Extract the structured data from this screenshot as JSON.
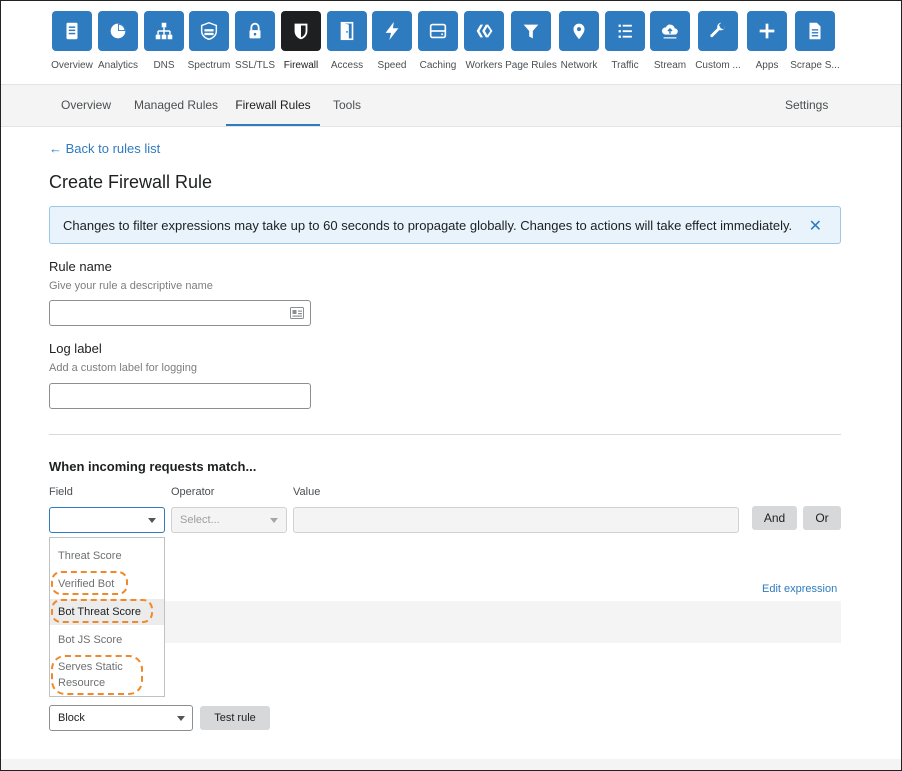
{
  "nav": {
    "items": [
      {
        "label": "Overview",
        "icon": "document-icon"
      },
      {
        "label": "Analytics",
        "icon": "pie-chart-icon"
      },
      {
        "label": "DNS",
        "icon": "network-tree-icon"
      },
      {
        "label": "Spectrum",
        "icon": "server-shield-icon"
      },
      {
        "label": "SSL/TLS",
        "icon": "lock-icon"
      },
      {
        "label": "Firewall",
        "icon": "shield-icon"
      },
      {
        "label": "Access",
        "icon": "door-icon"
      },
      {
        "label": "Speed",
        "icon": "lightning-icon"
      },
      {
        "label": "Caching",
        "icon": "storage-icon"
      },
      {
        "label": "Workers",
        "icon": "workers-icon"
      },
      {
        "label": "Page Rules",
        "icon": "filter-icon"
      },
      {
        "label": "Network",
        "icon": "location-pin-icon"
      },
      {
        "label": "Traffic",
        "icon": "list-icon"
      },
      {
        "label": "Stream",
        "icon": "cloud-upload-icon"
      },
      {
        "label": "Custom ...",
        "icon": "wrench-icon"
      },
      {
        "label": "Apps",
        "icon": "plus-icon"
      },
      {
        "label": "Scrape S...",
        "icon": "page-icon"
      }
    ],
    "active": "Firewall",
    "accent_color": "#2f7bbf",
    "active_color": "#1d1f20"
  },
  "subnav": {
    "tabs": [
      "Overview",
      "Managed Rules",
      "Firewall Rules",
      "Tools"
    ],
    "active": "Firewall Rules",
    "settings": "Settings"
  },
  "back_link": "← Back to rules list",
  "page_title": "Create Firewall Rule",
  "notice": {
    "text": "Changes to filter expressions may take up to 60 seconds to propagate globally. Changes to actions will take effect immediately.",
    "close": "✕"
  },
  "rule_name": {
    "label": "Rule name",
    "hint": "Give your rule a descriptive name",
    "value": ""
  },
  "log_label": {
    "label": "Log label",
    "hint": "Add a custom label for logging",
    "value": ""
  },
  "match": {
    "title": "When incoming requests match...",
    "field_label": "Field",
    "operator_label": "Operator",
    "value_label": "Value",
    "field_value": "",
    "operator_placeholder": "Select...",
    "value": "",
    "and_button": "And",
    "or_button": "Or",
    "edit_expression": "Edit expression"
  },
  "field_dropdown": {
    "options": [
      "Threat Score",
      "Verified Bot",
      "Bot Threat Score",
      "Bot JS Score",
      "Serves Static Resource"
    ],
    "highlighted": "Bot Threat Score",
    "annotated": [
      "Verified Bot",
      "Bot Threat Score",
      "Serves Static Resource"
    ],
    "annotation_color": "#f0892b"
  },
  "action": {
    "selected": "Block",
    "test_button": "Test rule"
  }
}
